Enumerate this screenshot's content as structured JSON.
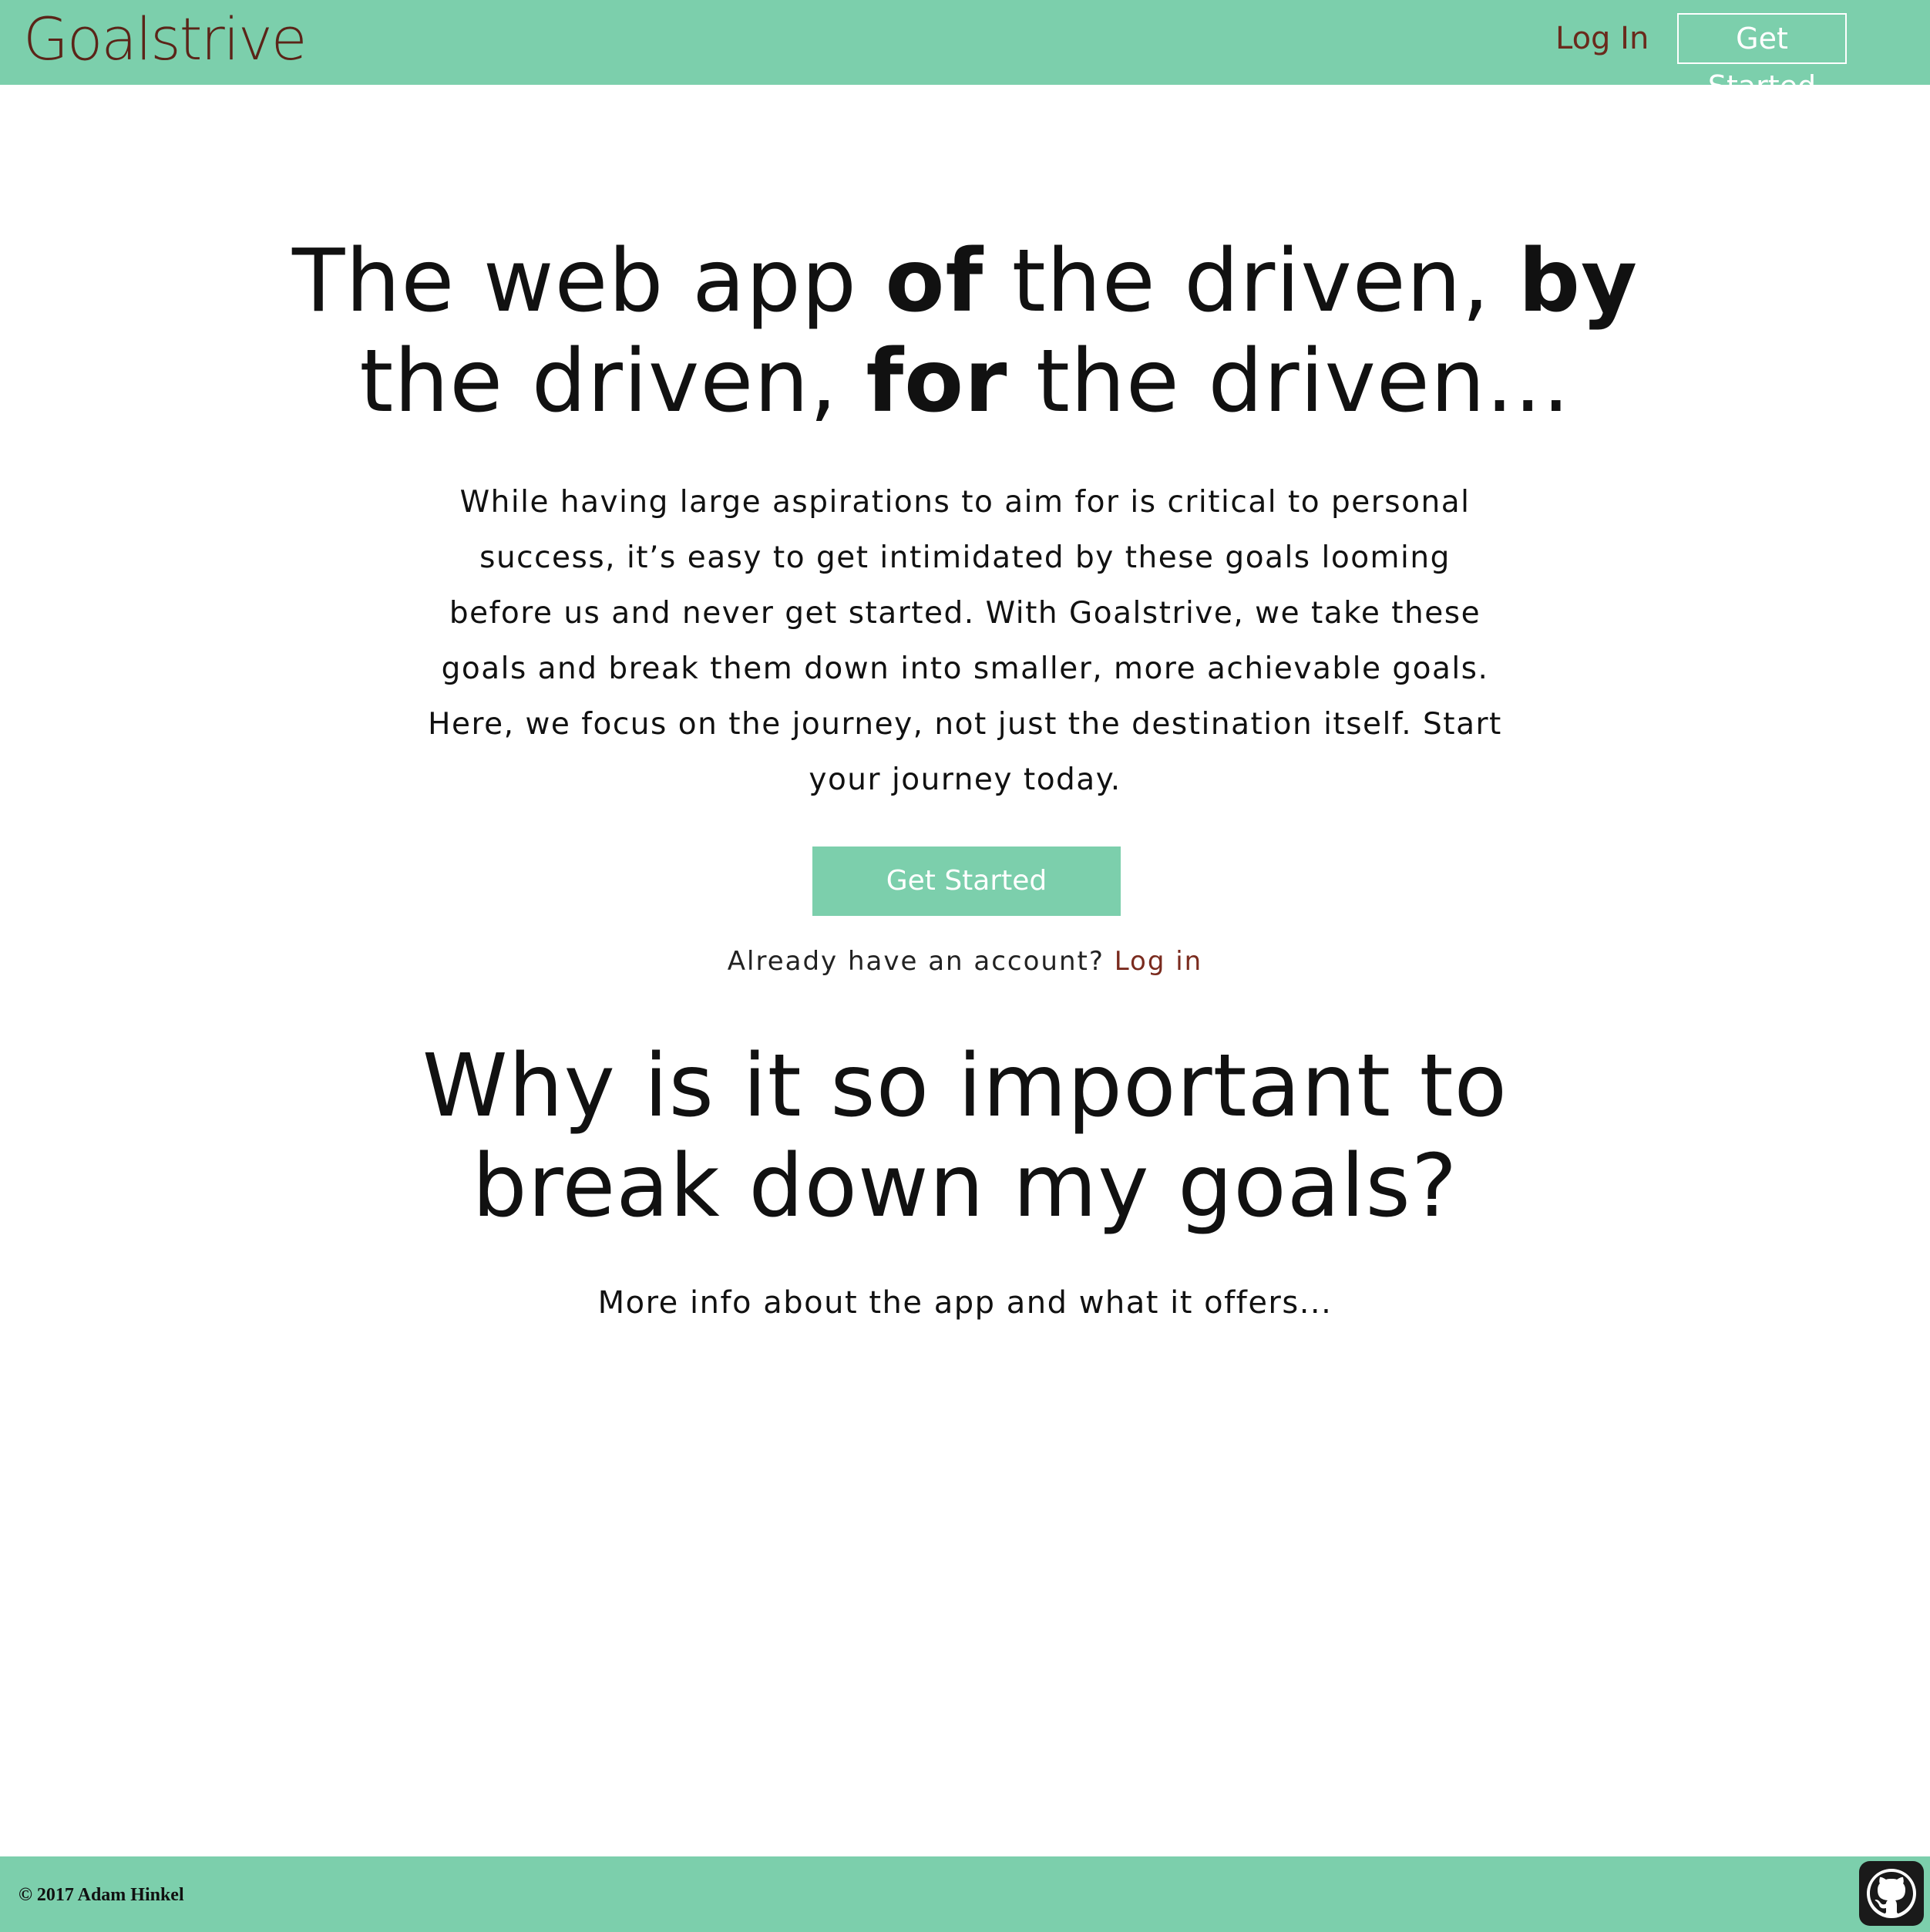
{
  "header": {
    "brand": "Goalstrive",
    "login_label": "Log In",
    "get_started_label": "Get Started"
  },
  "hero": {
    "title_parts": [
      "The web app ",
      "of",
      " the driven, ",
      "by",
      " the driven, ",
      "for",
      " the driven..."
    ],
    "paragraph": "While having large aspirations to aim for is critical to personal success, it’s easy to get intimidated by these goals looming before us and never get started. With Goalstrive, we take these goals and break them down into smaller, more achievable goals. Here, we focus on the journey, not just the destination itself. Start your journey today.",
    "cta_label": "Get Started",
    "account_prompt": "Already have an account?",
    "account_login_label": "Log in"
  },
  "info": {
    "heading": "Why is it so important to break down my goals?",
    "text": "More info about the app and what it offers..."
  },
  "footer": {
    "copyright": "© 2017 Adam Hinkel",
    "github_icon": "github-icon"
  },
  "colors": {
    "header_footer_bg": "#7ccfac",
    "brand_and_links": "#5b2418",
    "text": "#111111",
    "button_text": "#ffffff"
  }
}
